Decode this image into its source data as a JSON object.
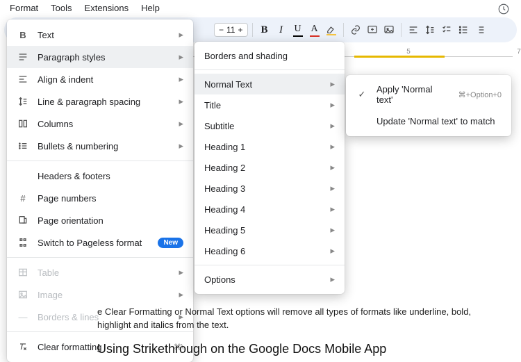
{
  "menubar": {
    "format": "Format",
    "tools": "Tools",
    "extensions": "Extensions",
    "help": "Help"
  },
  "toolbar": {
    "font_size": "11",
    "bold": "B",
    "italic": "I",
    "underline": "U",
    "textcolor": "A"
  },
  "ruler": {
    "lab5": "5",
    "lab7": "7"
  },
  "format_menu": {
    "text": "Text",
    "paragraph_styles": "Paragraph styles",
    "align_indent": "Align & indent",
    "line_paragraph_spacing": "Line & paragraph spacing",
    "columns": "Columns",
    "bullets_numbering": "Bullets & numbering",
    "headers_footers": "Headers & footers",
    "page_numbers": "Page numbers",
    "page_orientation": "Page orientation",
    "switch_pageless": "Switch to Pageless format",
    "new_badge": "New",
    "table": "Table",
    "image": "Image",
    "borders_lines": "Borders & lines",
    "clear_formatting": "Clear formatting",
    "clear_formatting_kbd": "⌘\\"
  },
  "para_menu": {
    "borders_shading": "Borders and shading",
    "normal_text": "Normal Text",
    "title": "Title",
    "subtitle": "Subtitle",
    "heading1": "Heading 1",
    "heading2": "Heading 2",
    "heading3": "Heading 3",
    "heading4": "Heading 4",
    "heading5": "Heading 5",
    "heading6": "Heading 6",
    "options": "Options"
  },
  "normal_menu": {
    "apply": "Apply 'Normal text'",
    "apply_kbd": "⌘+Option+0",
    "update": "Update 'Normal text' to match"
  },
  "doc": {
    "body": "e Clear Formatting or Normal Text options will remove all types of formats like underline, bold, highlight and italics from the text.",
    "heading": "Using Strikethrough on the Google Docs Mobile App"
  }
}
